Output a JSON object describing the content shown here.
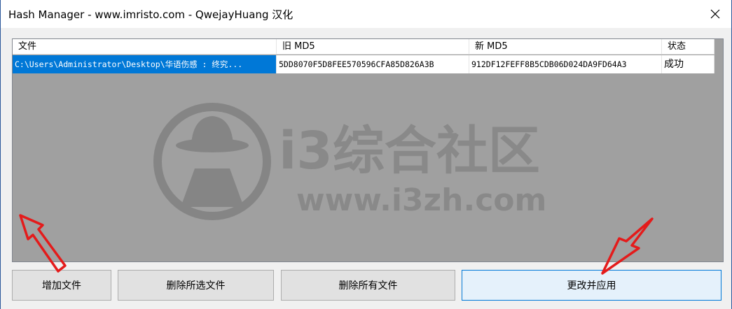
{
  "window": {
    "title": "Hash Manager - www.imristo.com - QwejayHuang 汉化"
  },
  "table": {
    "columns": [
      "文件",
      "旧 MD5",
      "新 MD5",
      "状态"
    ],
    "rows": [
      {
        "file": "C:\\Users\\Administrator\\Desktop\\华语伤感 : 终究...",
        "old_md5": "5DD8070F5D8FEE570596CFA85D826A3B",
        "new_md5": "912DF12FEFF8B5CDB06D024DA9FD64A3",
        "status": "成功"
      }
    ]
  },
  "watermark": {
    "brand": "i3综合社区",
    "url": "www.i3zh.com"
  },
  "buttons": {
    "add_files": "增加文件",
    "delete_selected": "删除所选文件",
    "delete_all": "删除所有文件",
    "modify_apply": "更改并应用"
  },
  "colors": {
    "selection": "#0078d7",
    "list_bg": "#a0a0a0",
    "arrow": "#e41b1b",
    "primary_border": "#0078d7"
  }
}
